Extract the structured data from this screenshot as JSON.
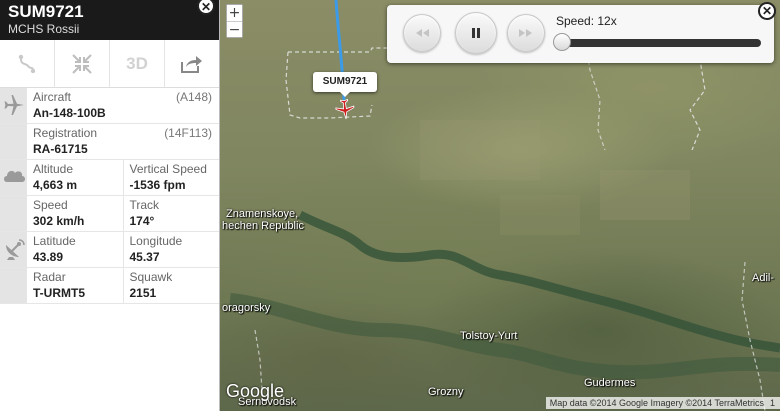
{
  "flight": {
    "number": "SUM9721",
    "airline": "MCHS Rossii",
    "callout_label": "SUM9721"
  },
  "toolbar": {
    "route_icon": "route-icon",
    "collapse_icon": "collapse-icon",
    "view3d_label": "3D",
    "share_icon": "share-icon"
  },
  "details": {
    "aircraft": {
      "label": "Aircraft",
      "value": "An-148-100B",
      "code": "(A148)"
    },
    "registration": {
      "label": "Registration",
      "value": "RA-61715",
      "code": "(14F113)"
    },
    "altitude": {
      "label": "Altitude",
      "value": "4,663 m"
    },
    "vertical_speed": {
      "label": "Vertical Speed",
      "value": "-1536 fpm"
    },
    "speed": {
      "label": "Speed",
      "value": "302 km/h"
    },
    "track": {
      "label": "Track",
      "value": "174°"
    },
    "latitude": {
      "label": "Latitude",
      "value": "43.89"
    },
    "longitude": {
      "label": "Longitude",
      "value": "45.37"
    },
    "radar": {
      "label": "Radar",
      "value": "T-URMT5"
    },
    "squawk": {
      "label": "Squawk",
      "value": "2151"
    }
  },
  "playback": {
    "speed_label": "Speed: 12x",
    "slider_fraction": 0.0
  },
  "map": {
    "zoom_in": "+",
    "zoom_out": "−",
    "labels": {
      "znamenskoye": "Znamenskoye,",
      "chechen_republic": "hechen Republic",
      "oragorsky": "oragorsky",
      "tolstoy_yurt": "Tolstoy-Yurt",
      "gudermes": "Gudermes",
      "grozny": "Grozny",
      "adil": "Adil-",
      "sernovodsk": "Sernovodsk"
    },
    "google_logo": "Google",
    "attribution": "Map data ©2014 Google Imagery ©2014 TerraMetrics",
    "scale": "1"
  },
  "colors": {
    "panel_header": "#1a1a1a",
    "flight_path": "#3b9be8",
    "aircraft": "#cc1f1f"
  }
}
